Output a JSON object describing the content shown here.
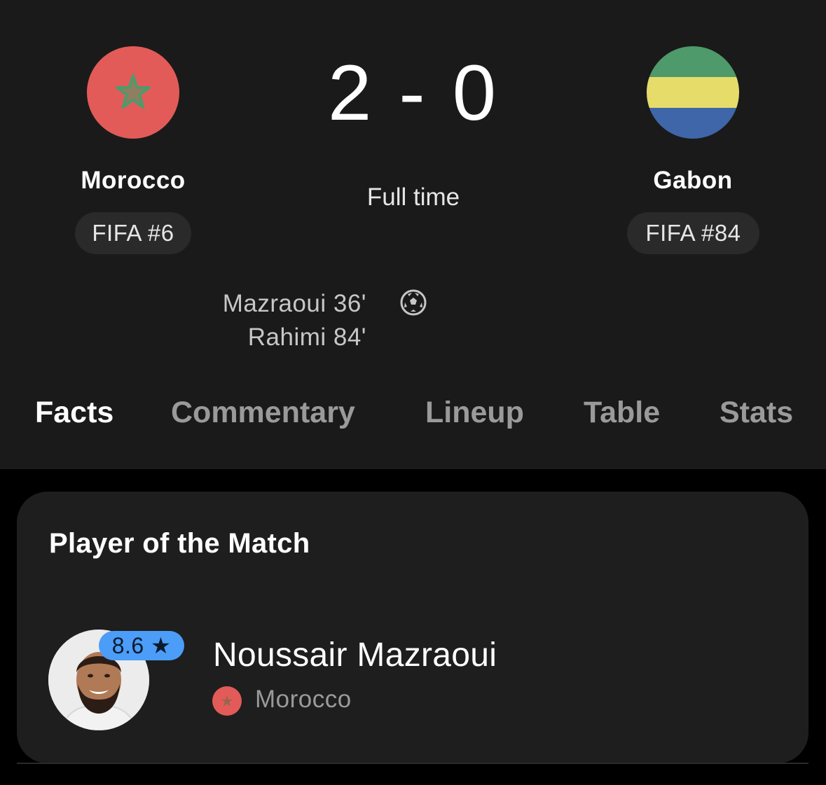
{
  "match": {
    "home": {
      "name": "Morocco",
      "rank": "FIFA #6",
      "flag_color": "#e25b58",
      "flag_icon": "morocco-flag-icon"
    },
    "away": {
      "name": "Gabon",
      "rank": "FIFA #84",
      "flag_colors": [
        "#4f9a6a",
        "#e6dc6a",
        "#3f66a8"
      ],
      "flag_icon": "gabon-flag-icon"
    },
    "score": "2 - 0",
    "status": "Full time",
    "goals": [
      {
        "player": "Mazraoui 36'"
      },
      {
        "player": "Rahimi 84'"
      }
    ],
    "goal_icon": "soccer-ball-icon"
  },
  "tabs": [
    {
      "label": "Facts",
      "active": true
    },
    {
      "label": "Commentary",
      "active": false
    },
    {
      "label": "Lineup",
      "active": false
    },
    {
      "label": "Table",
      "active": false
    },
    {
      "label": "Stats",
      "active": false
    }
  ],
  "player_of_match": {
    "title": "Player of the Match",
    "name": "Noussair Mazraoui",
    "rating": "8.6 ★",
    "country": "Morocco",
    "rating_color": "#4b9df7"
  }
}
